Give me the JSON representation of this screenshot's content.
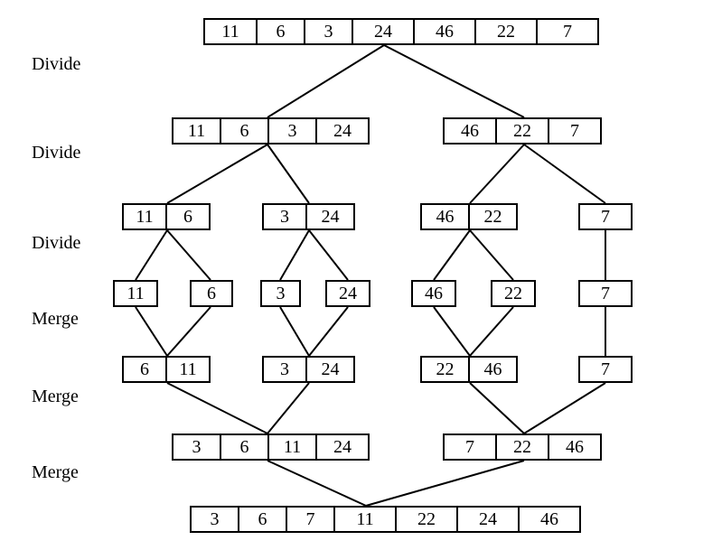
{
  "labels": {
    "divide1": "Divide",
    "divide2": "Divide",
    "divide3": "Divide",
    "merge1": "Merge",
    "merge2": "Merge",
    "merge3": "Merge"
  },
  "rows": {
    "r0": [
      "11",
      "6",
      "3",
      "24",
      "46",
      "22",
      "7"
    ],
    "r1_left": [
      "11",
      "6",
      "3",
      "24"
    ],
    "r1_right": [
      "46",
      "22",
      "7"
    ],
    "r2_a": [
      "11",
      "6"
    ],
    "r2_b": [
      "3",
      "24"
    ],
    "r2_c": [
      "46",
      "22"
    ],
    "r2_d": [
      "7"
    ],
    "r3_a": [
      "11"
    ],
    "r3_b": [
      "6"
    ],
    "r3_c": [
      "3"
    ],
    "r3_d": [
      "24"
    ],
    "r3_e": [
      "46"
    ],
    "r3_f": [
      "22"
    ],
    "r3_g": [
      "7"
    ],
    "r4_a": [
      "6",
      "11"
    ],
    "r4_b": [
      "3",
      "24"
    ],
    "r4_c": [
      "22",
      "46"
    ],
    "r4_d": [
      "7"
    ],
    "r5_left": [
      "3",
      "6",
      "11",
      "24"
    ],
    "r5_right": [
      "7",
      "22",
      "46"
    ],
    "r6": [
      "3",
      "6",
      "7",
      "11",
      "22",
      "24",
      "46"
    ]
  }
}
